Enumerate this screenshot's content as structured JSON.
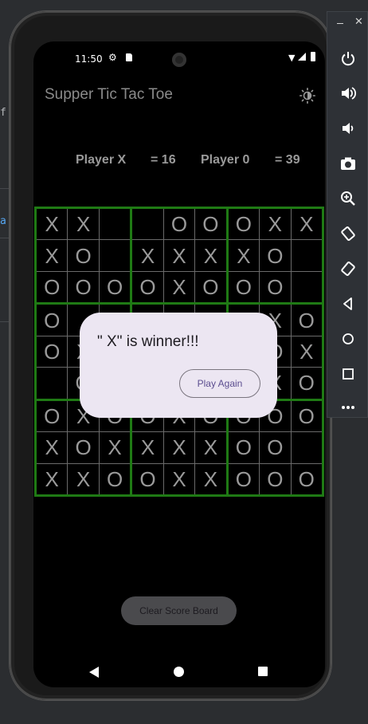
{
  "status_bar": {
    "time": "11:50"
  },
  "app": {
    "title": "Supper Tic Tac Toe",
    "icons": {
      "theme": "sun-icon"
    }
  },
  "score": {
    "player_x_label": "Player X",
    "player_x_value": "= 16",
    "player_o_label": "Player 0",
    "player_o_value": "= 39"
  },
  "board": [
    [
      [
        "X",
        "X",
        ""
      ],
      [
        "X",
        "O",
        ""
      ],
      [
        "O",
        "O",
        "O"
      ]
    ],
    [
      [
        "",
        "O",
        "O"
      ],
      [
        "X",
        "X",
        "X"
      ],
      [
        "O",
        "X",
        "O"
      ]
    ],
    [
      [
        "O",
        "X",
        "X"
      ],
      [
        "X",
        "O",
        ""
      ],
      [
        "O",
        "O",
        ""
      ]
    ],
    [
      [
        "O",
        "",
        ""
      ],
      [
        "O",
        "X",
        ""
      ],
      [
        "",
        "O",
        ""
      ]
    ],
    [
      [
        "",
        "",
        ""
      ],
      [
        "",
        "",
        ""
      ],
      [
        "",
        "",
        ""
      ]
    ],
    [
      [
        "",
        "X",
        "O"
      ],
      [
        "",
        "O",
        "X"
      ],
      [
        "",
        "X",
        "O"
      ]
    ],
    [
      [
        "O",
        "X",
        "O"
      ],
      [
        "X",
        "O",
        "X"
      ],
      [
        "X",
        "X",
        "O"
      ]
    ],
    [
      [
        "O",
        "X",
        "O"
      ],
      [
        "X",
        "X",
        "X"
      ],
      [
        "O",
        "X",
        "X"
      ]
    ],
    [
      [
        "O",
        "O",
        "O"
      ],
      [
        "O",
        "O",
        ""
      ],
      [
        "O",
        "O",
        "O"
      ]
    ]
  ],
  "dialog": {
    "message": "\" X\" is winner!!!",
    "play_again_label": "Play Again"
  },
  "clear_button_label": "Clear Score Board",
  "colors": {
    "board_border": "#1f7a14",
    "dialog_bg": "#ece6f2",
    "accent_text": "#5b4d8f"
  }
}
